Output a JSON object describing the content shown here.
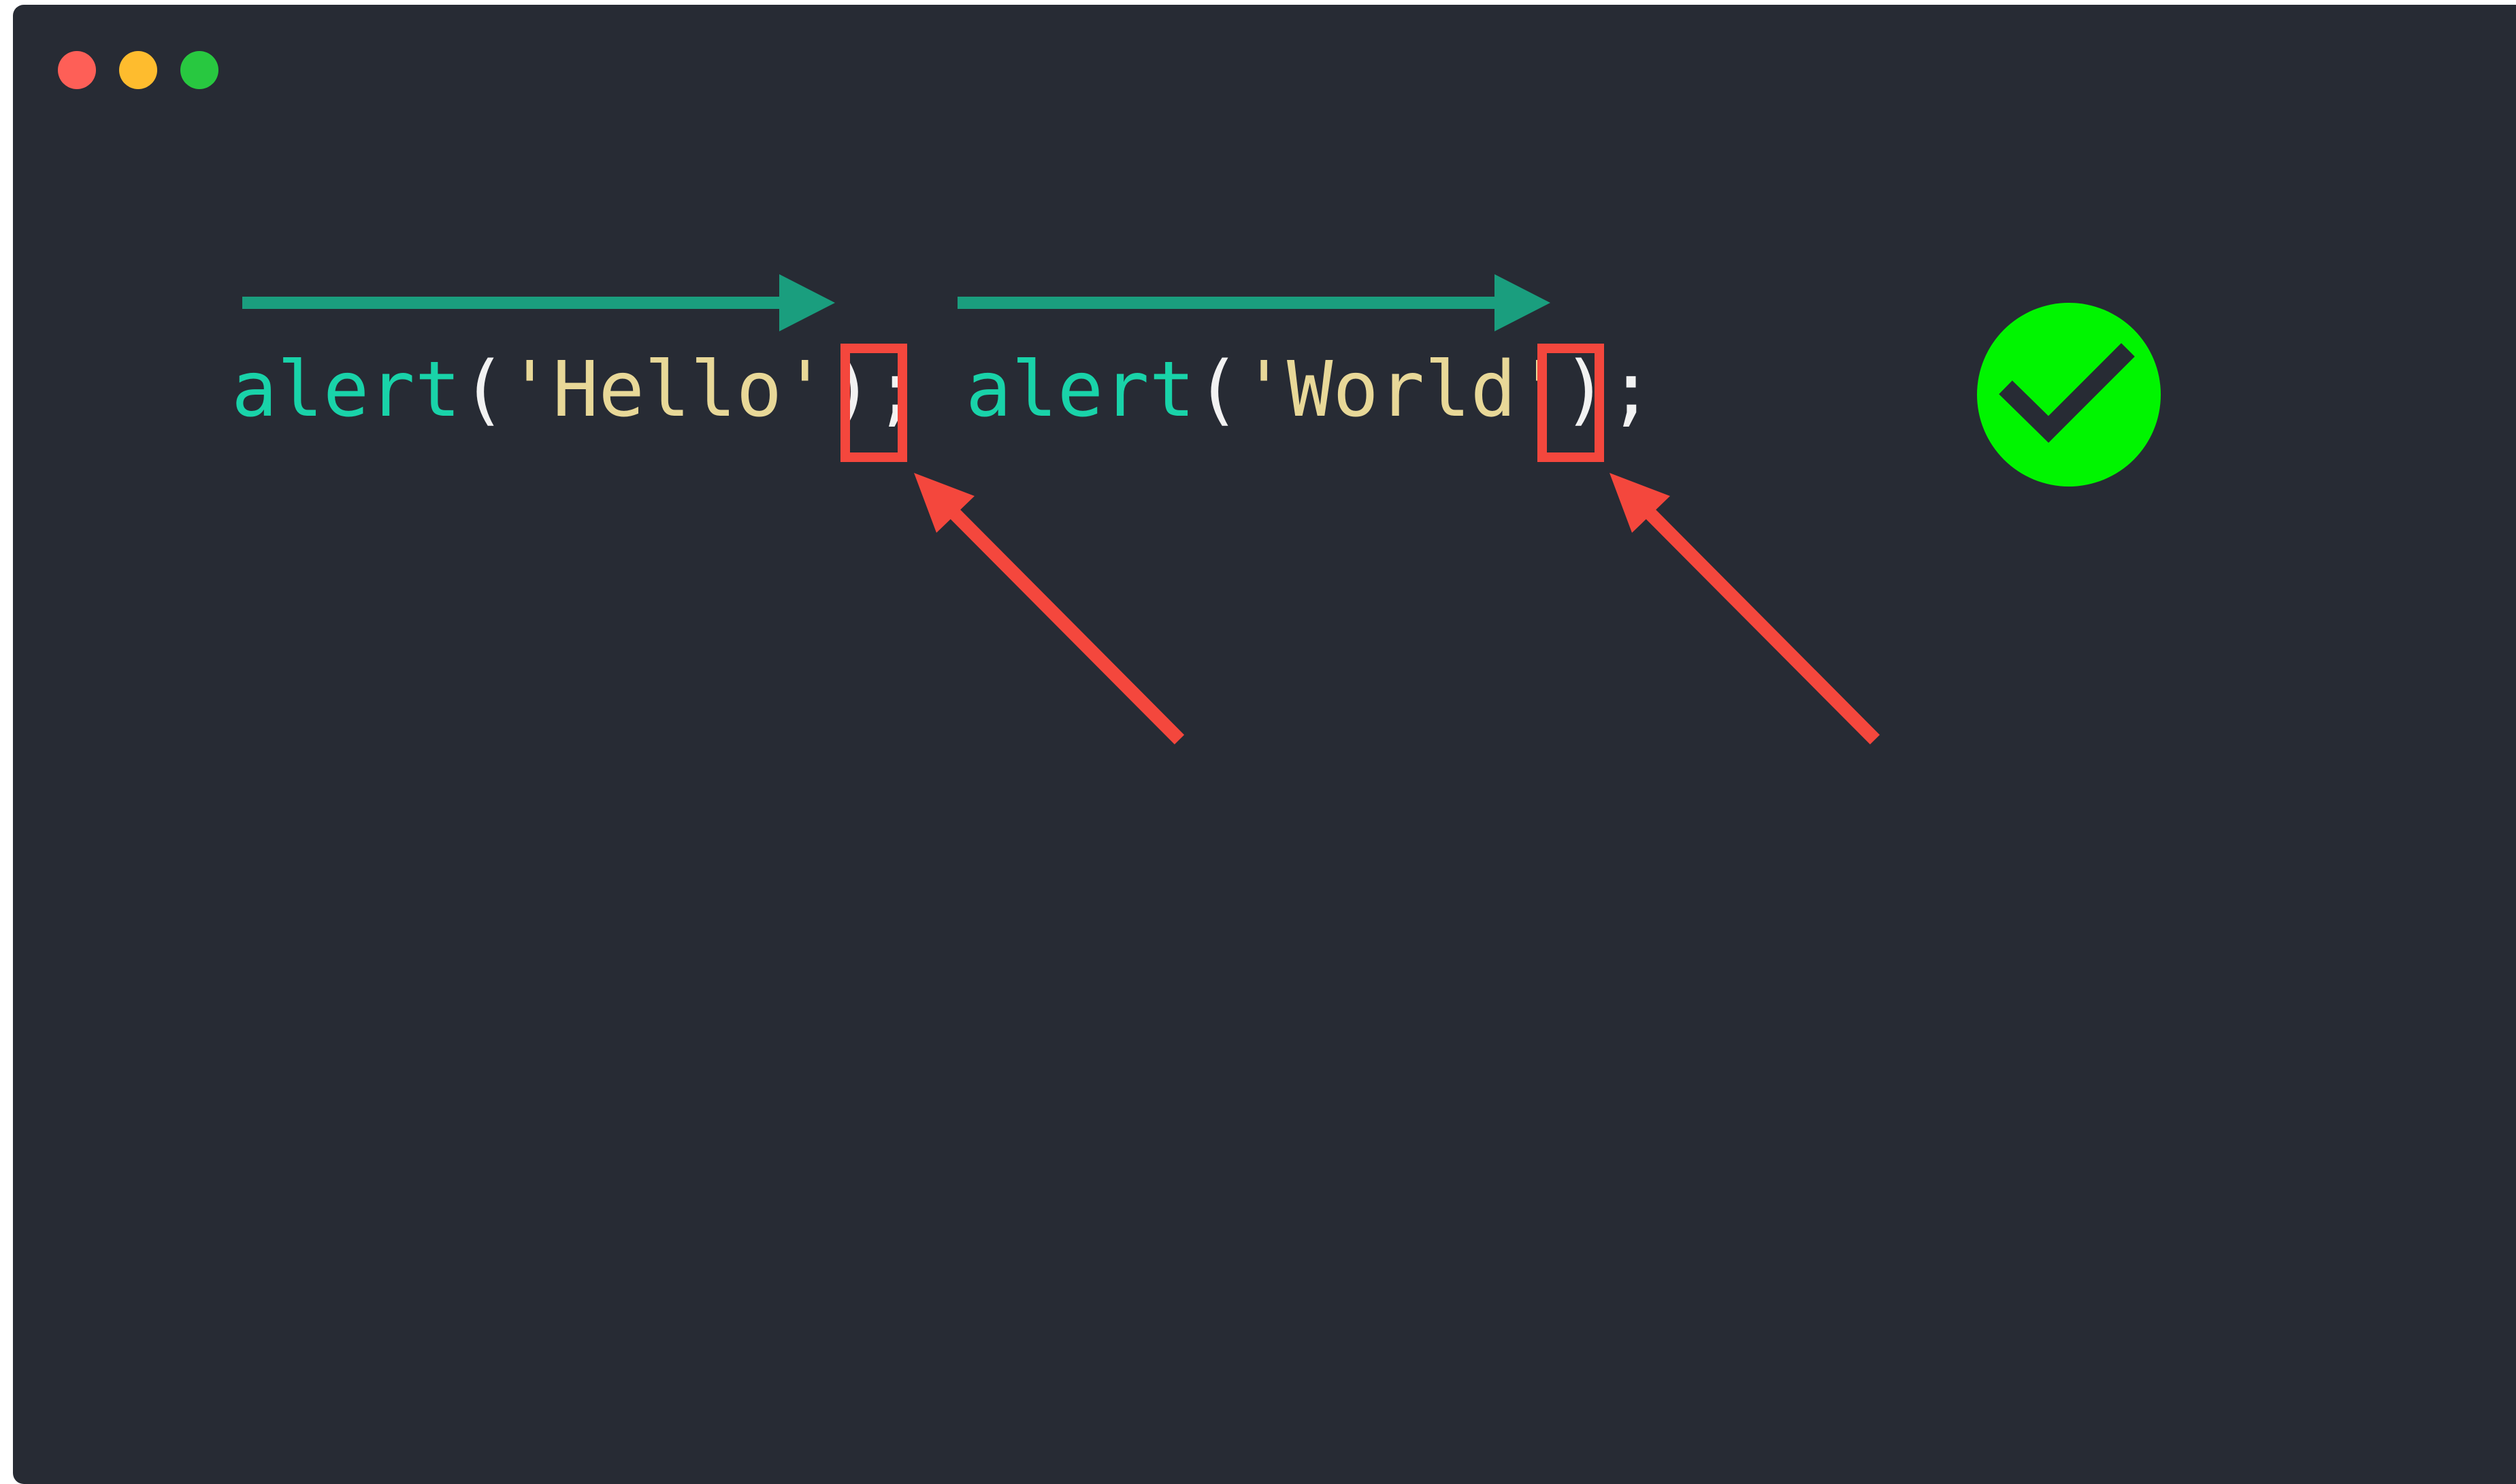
{
  "window": {
    "traffic_lights": [
      {
        "name": "close",
        "color": "#fe5f57"
      },
      {
        "name": "minimize",
        "color": "#febc2e"
      },
      {
        "name": "maximize",
        "color": "#28c840"
      }
    ],
    "background": "#272b34"
  },
  "code": {
    "statements": [
      {
        "fn": "alert",
        "open": "(",
        "arg": "'Hello'",
        "close": ")",
        "semi": ";"
      },
      {
        "fn": "alert",
        "open": "(",
        "arg": "'World'",
        "close": ")",
        "semi": ";"
      }
    ],
    "separator": " "
  },
  "annotations": {
    "flow_arrow_color": "#1a9e7e",
    "highlight_color": "#f4473d",
    "pointer_arrow_color": "#f4473d",
    "status_icon": "check-circle-icon",
    "status_color": "#00f500"
  }
}
